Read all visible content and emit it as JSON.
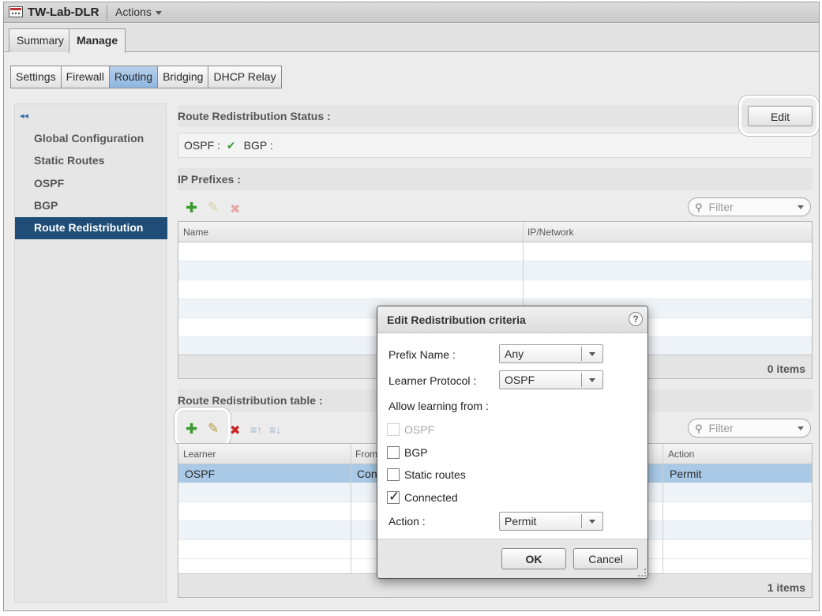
{
  "titlebar": {
    "title": "TW-Lab-DLR",
    "actions_label": "Actions"
  },
  "top_tabs": [
    {
      "label": "Summary"
    },
    {
      "label": "Manage"
    }
  ],
  "sub_tabs": [
    {
      "label": "Settings"
    },
    {
      "label": "Firewall"
    },
    {
      "label": "Routing"
    },
    {
      "label": "Bridging"
    },
    {
      "label": "DHCP Relay"
    }
  ],
  "sidebar": {
    "collapse_glyph": "◂◂",
    "items": [
      {
        "label": "Global Configuration"
      },
      {
        "label": "Static Routes"
      },
      {
        "label": "OSPF"
      },
      {
        "label": "BGP"
      },
      {
        "label": "Route Redistribution"
      }
    ]
  },
  "status": {
    "header": "Route Redistribution Status :",
    "edit_label": "Edit",
    "ospf_label": "OSPF :",
    "ospf_check": "✔",
    "bgp_label": "BGP :"
  },
  "prefixes": {
    "header": "IP Prefixes :",
    "filter_placeholder": "Filter",
    "columns": [
      "Name",
      "IP/Network"
    ],
    "footer": "0 items"
  },
  "redistribution": {
    "header": "Route Redistribution table :",
    "filter_placeholder": "Filter",
    "columns": [
      "Learner",
      "From",
      "Action"
    ],
    "rows": [
      {
        "learner": "OSPF",
        "from": "Con",
        "action": "Permit"
      }
    ],
    "footer": "1 items"
  },
  "dialog": {
    "title": "Edit Redistribution criteria",
    "help": "?",
    "prefix_label": "Prefix Name :",
    "prefix_value": "Any",
    "learner_label": "Learner Protocol :",
    "learner_value": "OSPF",
    "allow_label": "Allow learning from :",
    "options": [
      {
        "label": "OSPF",
        "checked": false,
        "disabled": true
      },
      {
        "label": "BGP",
        "checked": false,
        "disabled": false
      },
      {
        "label": "Static routes",
        "checked": false,
        "disabled": false
      },
      {
        "label": "Connected",
        "checked": true,
        "disabled": false
      }
    ],
    "action_label": "Action :",
    "action_value": "Permit",
    "ok_label": "OK",
    "cancel_label": "Cancel"
  },
  "colors": {
    "accent": "#1f4d78",
    "selected_row": "#a9c9e6",
    "add": "#3a9a2e",
    "delete": "#cc2222"
  }
}
